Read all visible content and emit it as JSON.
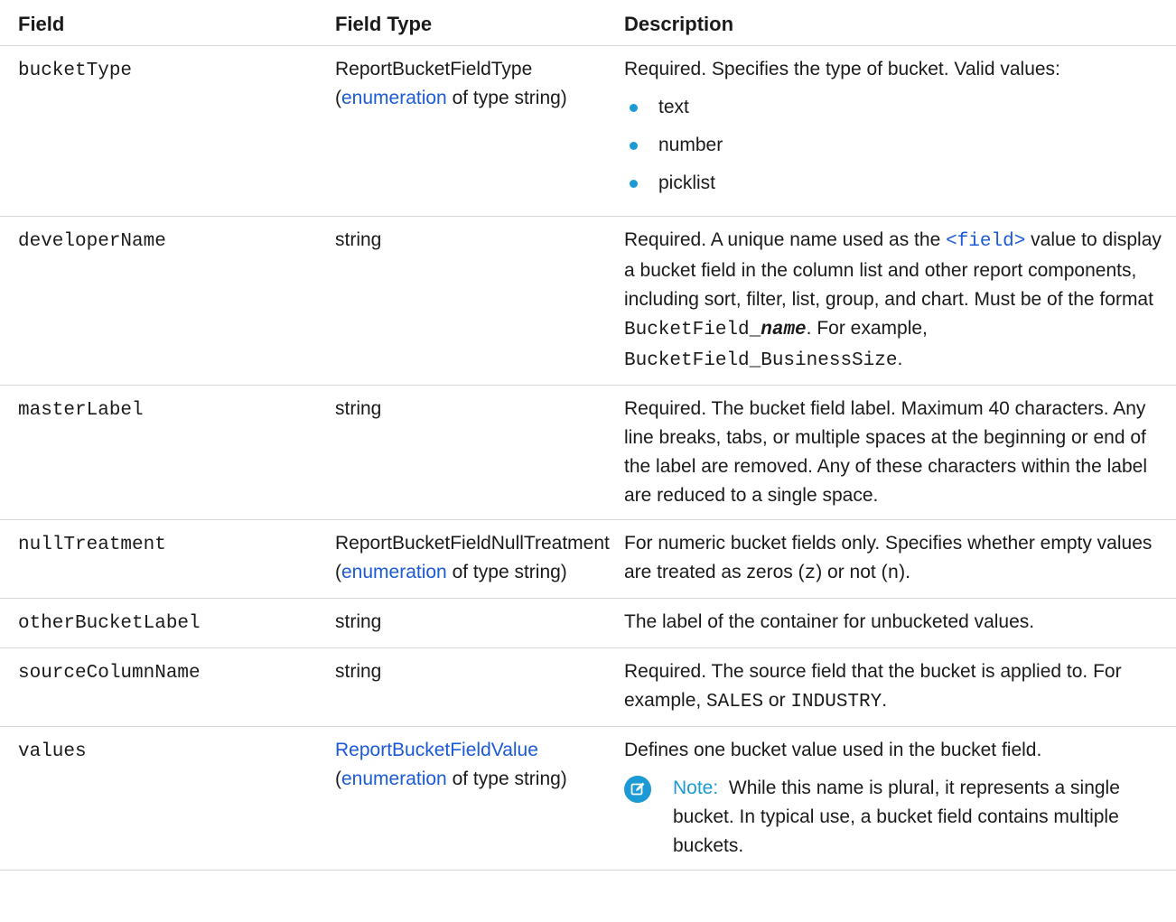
{
  "headers": {
    "field": "Field",
    "field_type": "Field Type",
    "description": "Description"
  },
  "rows": {
    "bucketType": {
      "field": "bucketType",
      "type_main": "ReportBucketFieldType",
      "type_open": "(",
      "type_link": "enumeration",
      "type_tail": " of type string)",
      "desc": "Required. Specifies the type of bucket. Valid values:",
      "values": [
        "text",
        "number",
        "picklist"
      ]
    },
    "developerName": {
      "field": "developerName",
      "type": "string",
      "desc_1": "Required. A unique name used as the ",
      "desc_link": "<field>",
      "desc_2": " value to display a bucket field in the column list and other report components, including sort, filter, list, group, and chart. Must be of the format ",
      "desc_code_1": "BucketField_",
      "desc_code_bi": "name",
      "desc_3": ". For example, ",
      "desc_code_2": "BucketField_BusinessSize",
      "desc_4": "."
    },
    "masterLabel": {
      "field": "masterLabel",
      "type": "string",
      "desc": "Required. The bucket field label. Maximum 40 characters. Any line breaks, tabs, or multiple spaces at the beginning or end of the label are removed. Any of these characters within the label are reduced to a single space."
    },
    "nullTreatment": {
      "field": "nullTreatment",
      "type_main": "ReportBucketFieldNullTreatment",
      "type_open": "(",
      "type_link": "enumeration",
      "type_tail": " of type string)",
      "desc_1": "For numeric bucket fields only. Specifies whether empty values are treated as zeros (",
      "desc_code_1": "z",
      "desc_2": ") or not (",
      "desc_code_2": "n",
      "desc_3": ")."
    },
    "otherBucketLabel": {
      "field": "otherBucketLabel",
      "type": "string",
      "desc": "The label of the container for unbucketed values."
    },
    "sourceColumnName": {
      "field": "sourceColumnName",
      "type": "string",
      "desc_1": "Required. The source field that the bucket is applied to. For example, ",
      "desc_code_1": "SALES",
      "desc_2": " or ",
      "desc_code_2": "INDUSTRY",
      "desc_3": "."
    },
    "values": {
      "field": "values",
      "type_link_1": "ReportBucketFieldValue",
      "type_open": "(",
      "type_link": "enumeration",
      "type_tail": " of type string)",
      "desc": "Defines one bucket value used in the bucket field.",
      "note_label": "Note:",
      "note_text": "While this name is plural, it represents a single bucket. In typical use, a bucket field contains multiple buckets.",
      "note_icon": "edit-note-icon"
    }
  },
  "colors": {
    "link": "#1a5ad7",
    "accent": "#1b9ad6",
    "rule": "#d6d6d6"
  }
}
